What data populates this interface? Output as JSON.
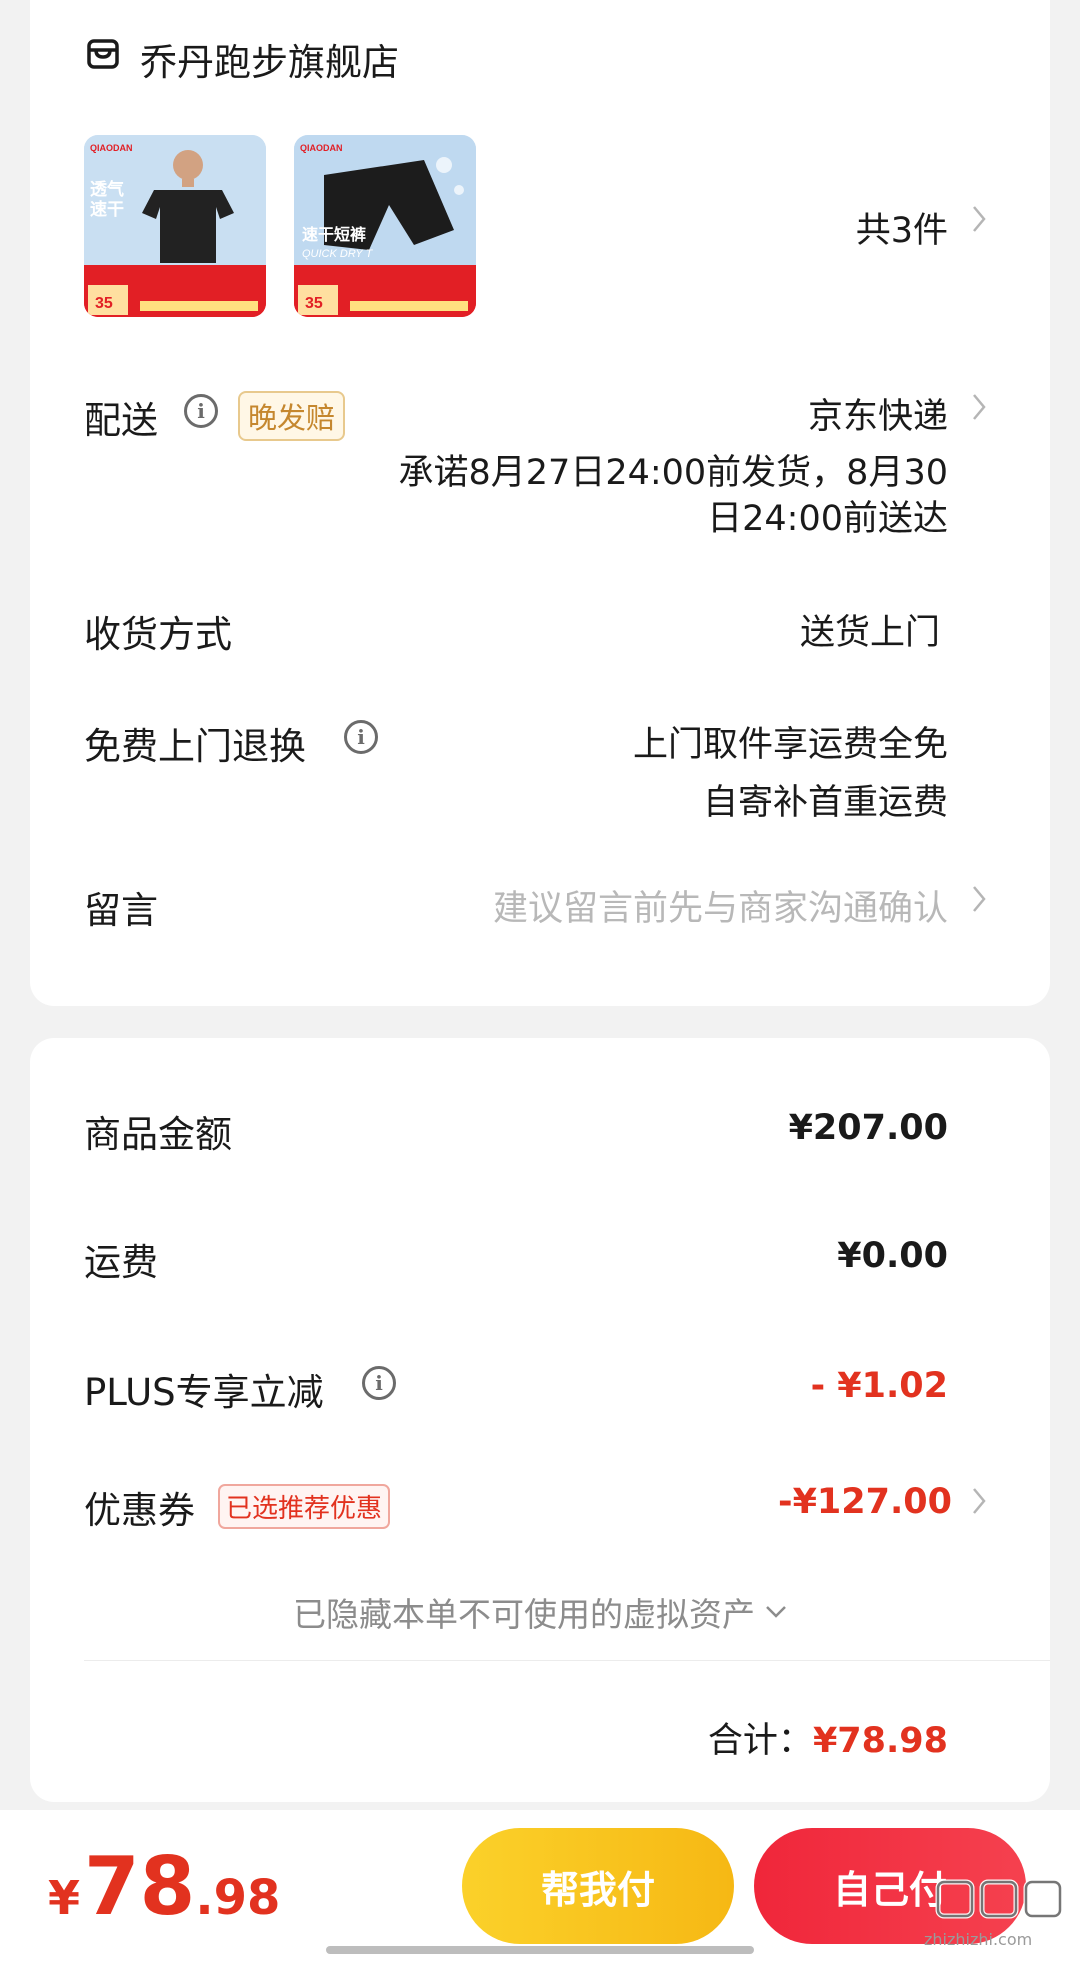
{
  "store": {
    "name": "乔丹跑步旗舰店",
    "icon": "store-icon"
  },
  "products": {
    "count_label": "共3件",
    "items": [
      {
        "name": "product-tshirt",
        "overlay_title": "透气\n速干",
        "price_tag": "35"
      },
      {
        "name": "product-shorts",
        "overlay_title": "速干短裤",
        "overlay_sub": "QUICK DRY T",
        "price_tag": "35"
      }
    ]
  },
  "delivery": {
    "label": "配送",
    "badge": "晚发赔",
    "carrier": "京东快递",
    "promise_line1": "承诺8月27日24:00前发货，8月30",
    "promise_line2": "日24:00前送达"
  },
  "receive": {
    "label": "收货方式",
    "value": "送货上门"
  },
  "free_return": {
    "label": "免费上门退换",
    "line1": "上门取件享运费全免",
    "line2": "自寄补首重运费"
  },
  "message": {
    "label": "留言",
    "placeholder": "建议留言前先与商家沟通确认"
  },
  "price": {
    "goods_label": "商品金额",
    "goods_value": "¥207.00",
    "shipping_label": "运费",
    "shipping_value": "¥0.00",
    "plus_label": "PLUS专享立减",
    "plus_value": "- ¥1.02",
    "coupon_label": "优惠券",
    "coupon_badge": "已选推荐优惠",
    "coupon_value": "-¥127.00",
    "hidden_assets": "已隐藏本单不可使用的虚拟资产",
    "total_label": "合计：",
    "total_value": "¥78.98"
  },
  "bottom_bar": {
    "currency": "¥",
    "amount_int": "78",
    "amount_dec": ".98",
    "help_pay": "帮我付",
    "self_pay": "自己付"
  },
  "watermark": {
    "text": "zhizhizhi.com"
  },
  "colors": {
    "accent_red": "#e2321f",
    "help_pay_bg": "#f8c41a",
    "self_pay_bg": "#f0263a",
    "badge_gold": "#c5872e"
  }
}
